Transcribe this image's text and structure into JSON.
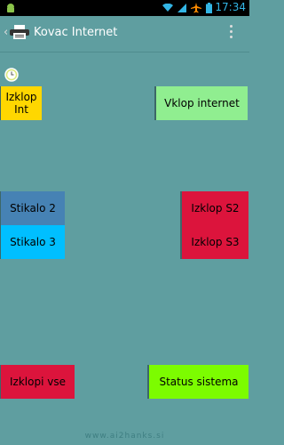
{
  "status_bar": {
    "time": "17:34",
    "icons": [
      "android-icon",
      "wifi-icon",
      "signal-icon",
      "airplane-icon",
      "battery-icon"
    ]
  },
  "app_bar": {
    "title": "Kovac Internet",
    "icon": "printer-icon"
  },
  "buttons": {
    "izklop_int": {
      "label": "Izklop Int",
      "color": "#ffd700"
    },
    "vklop_internet": {
      "label": "Vklop internet",
      "color": "#90ee90"
    },
    "stikalo_2": {
      "label": "Stikalo 2",
      "color": "#4682b4"
    },
    "izklop_s2": {
      "label": "Izklop S2",
      "color": "#dc143c"
    },
    "stikalo_3": {
      "label": "Stikalo 3",
      "color": "#00bfff"
    },
    "izklop_s3": {
      "label": "Izklop S3",
      "color": "#dc143c"
    },
    "izklopi_vse": {
      "label": "Izklopi vse",
      "color": "#dc143c"
    },
    "status_sistema": {
      "label": "Status sistema",
      "color": "#7cfc00"
    }
  },
  "watermark": "www.ai2hanks.si"
}
